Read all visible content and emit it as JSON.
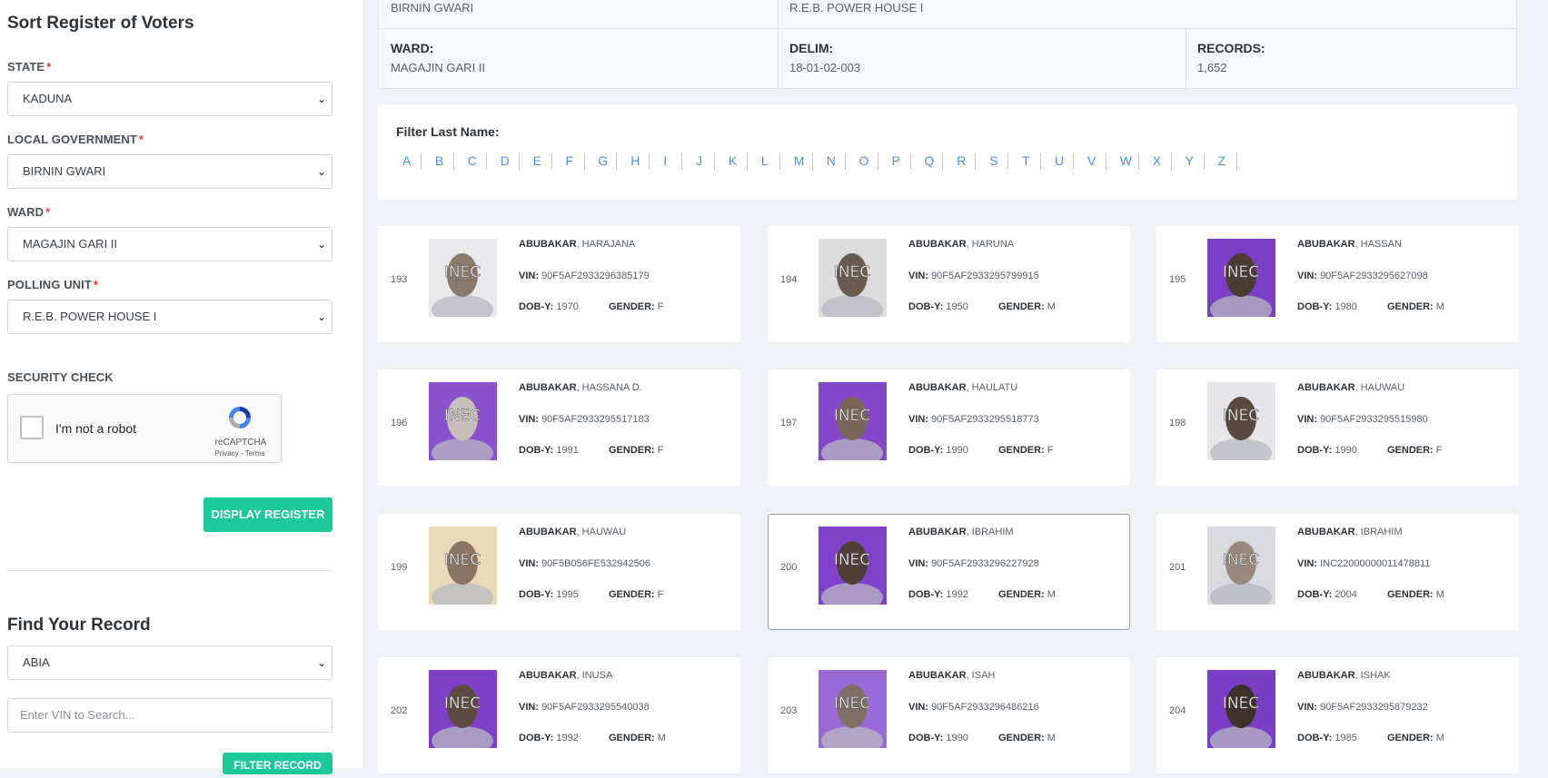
{
  "sidebar": {
    "title": "Sort Register of Voters",
    "state_label": "STATE",
    "state_value": "KADUNA",
    "lga_label": "LOCAL GOVERNMENT",
    "lga_value": "BIRNIN GWARI",
    "ward_label": "WARD",
    "ward_value": "MAGAJIN GARI II",
    "pu_label": "POLLING UNIT",
    "pu_value": "R.E.B. POWER HOUSE I",
    "required_mark": "*",
    "security_label": "SECURITY CHECK",
    "captcha_text": "I'm not a robot",
    "captcha_brand": "reCAPTCHA",
    "captcha_links": "Privacy - Terms",
    "display_button": "DISPLAY REGISTER",
    "find_title": "Find Your Record",
    "find_state_value": "ABIA",
    "vin_placeholder": "Enter VIN to Search...",
    "filter_button": "FILTER RECORD"
  },
  "info": {
    "lga_value": "BIRNIN GWARI",
    "pu_value": "R.E.B. POWER HOUSE I",
    "ward_label": "WARD:",
    "ward_value": "MAGAJIN GARI II",
    "delim_label": "DELIM:",
    "delim_value": "18-01-02-003",
    "records_label": "RECORDS:",
    "records_value": "1,652"
  },
  "filter": {
    "label": "Filter Last Name:",
    "letters": [
      "A",
      "B",
      "C",
      "D",
      "E",
      "F",
      "G",
      "H",
      "I",
      "J",
      "K",
      "L",
      "M",
      "N",
      "O",
      "P",
      "Q",
      "R",
      "S",
      "T",
      "U",
      "V",
      "W",
      "X",
      "Y",
      "Z"
    ]
  },
  "labels": {
    "vin": "VIN:",
    "dob": "DOB-Y:",
    "gender": "GENDER:"
  },
  "voters": [
    {
      "num": "193",
      "surname": "ABUBAKAR",
      "given": ", HARAJANA",
      "vin": "90F5AF2933296385179",
      "dob": "1970",
      "gender": "F",
      "bg": "#e9e9ec"
    },
    {
      "num": "194",
      "surname": "ABUBAKAR",
      "given": ", HARUNA",
      "vin": "90F5AF2933295799915",
      "dob": "1950",
      "gender": "M",
      "bg": "#dcdcdc"
    },
    {
      "num": "195",
      "surname": "ABUBAKAR",
      "given": ", HASSAN",
      "vin": "90F5AF2933295627098",
      "dob": "1980",
      "gender": "M",
      "bg": "#7a3fc4"
    },
    {
      "num": "196",
      "surname": "ABUBAKAR",
      "given": ", HASSANA D.",
      "vin": "90F5AF2933295517183",
      "dob": "1991",
      "gender": "F",
      "bg": "#8a52cf"
    },
    {
      "num": "197",
      "surname": "ABUBAKAR",
      "given": ", HAULATU",
      "vin": "90F5AF2933295518773",
      "dob": "1990",
      "gender": "F",
      "bg": "#8447cc"
    },
    {
      "num": "198",
      "surname": "ABUBAKAR",
      "given": ", HAUWAU",
      "vin": "90F5AF2933295515980",
      "dob": "1990",
      "gender": "F",
      "bg": "#e6e6ea"
    },
    {
      "num": "199",
      "surname": "ABUBAKAR",
      "given": ", HAUWAU",
      "vin": "90F5B056FE532942506",
      "dob": "1995",
      "gender": "F",
      "bg": "#e9d9b8"
    },
    {
      "num": "200",
      "surname": "ABUBAKAR",
      "given": ", IBRAHIM",
      "vin": "90F5AF2933296227928",
      "dob": "1992",
      "gender": "M",
      "bg": "#8042cc"
    },
    {
      "num": "201",
      "surname": "ABUBAKAR",
      "given": ", IBRAHIM",
      "vin": "INC22000000011478811",
      "dob": "2004",
      "gender": "M",
      "bg": "#d8dadf"
    },
    {
      "num": "202",
      "surname": "ABUBAKAR",
      "given": ", INUSA",
      "vin": "90F5AF2933295540038",
      "dob": "1992",
      "gender": "M",
      "bg": "#7d40c6"
    },
    {
      "num": "203",
      "surname": "ABUBAKAR",
      "given": ", ISAH",
      "vin": "90F5AF2933296486216",
      "dob": "1990",
      "gender": "M",
      "bg": "#9a6ad6"
    },
    {
      "num": "204",
      "surname": "ABUBAKAR",
      "given": ", ISHAK",
      "vin": "90F5AF2933295879232",
      "dob": "1985",
      "gender": "M",
      "bg": "#7a3ec6"
    }
  ],
  "photo_watermark": "INEC",
  "colors": {
    "accent_green": "#1bc89a",
    "link_blue": "#4a90e2",
    "required_red": "#e53935"
  }
}
